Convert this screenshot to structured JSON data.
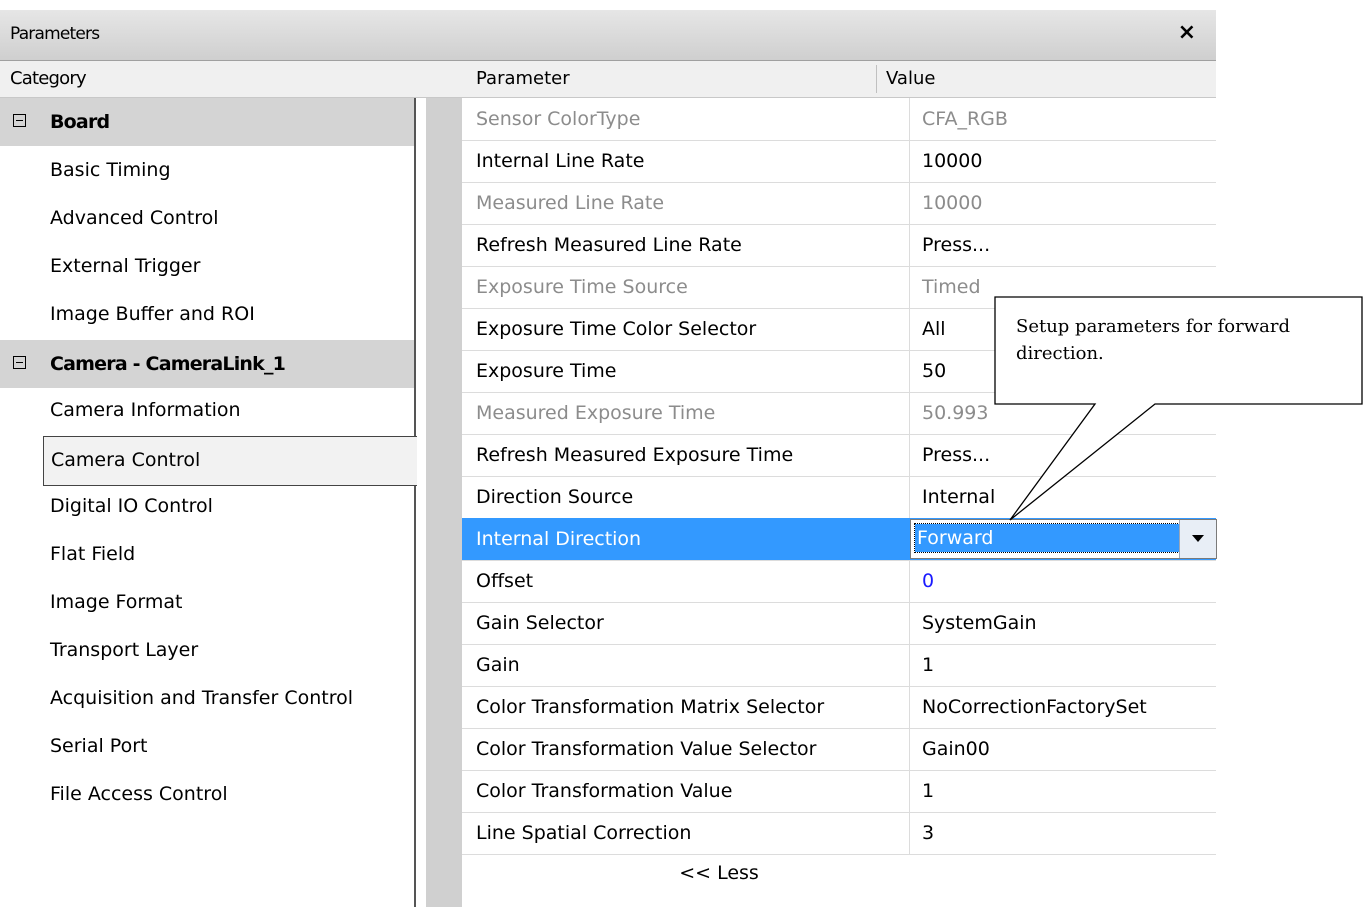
{
  "window": {
    "title": "Parameters",
    "close_symbol": "×"
  },
  "headers": {
    "category": "Category",
    "parameter": "Parameter",
    "value": "Value"
  },
  "categories": {
    "board_group": "Board",
    "board_items": [
      "Basic Timing",
      "Advanced Control",
      "External Trigger",
      "Image Buffer and ROI"
    ],
    "camera_group": "Camera - CameraLink_1",
    "camera_items": [
      "Camera Information",
      "Camera Control",
      "Digital IO Control",
      "Flat Field",
      "Image Format",
      "Transport Layer",
      "Acquisition and Transfer Control",
      "Serial Port",
      "File Access Control"
    ],
    "selected": "Camera Control"
  },
  "parameters": [
    {
      "name": "Sensor ColorType",
      "value": "CFA_RGB",
      "readonly": true
    },
    {
      "name": "Internal Line Rate",
      "value": "10000",
      "readonly": false
    },
    {
      "name": "Measured Line Rate",
      "value": "10000",
      "readonly": true
    },
    {
      "name": "Refresh Measured Line Rate",
      "value": "Press...",
      "readonly": false
    },
    {
      "name": "Exposure Time Source",
      "value": "Timed",
      "readonly": true
    },
    {
      "name": "Exposure Time Color Selector",
      "value": "All",
      "readonly": false
    },
    {
      "name": "Exposure Time",
      "value": "50",
      "readonly": false
    },
    {
      "name": "Measured Exposure Time",
      "value": "50.993",
      "readonly": true
    },
    {
      "name": "Refresh Measured Exposure Time",
      "value": "Press...",
      "readonly": false
    },
    {
      "name": "Direction Source",
      "value": "Internal",
      "readonly": false
    },
    {
      "name": "Internal Direction",
      "value": "Forward",
      "readonly": false,
      "selected": true,
      "dropdown": true
    },
    {
      "name": "Offset",
      "value": "0",
      "readonly": false,
      "value_color": "#1a1aff"
    },
    {
      "name": "Gain Selector",
      "value": "SystemGain",
      "readonly": false
    },
    {
      "name": "Gain",
      "value": "1",
      "readonly": false
    },
    {
      "name": "Color Transformation Matrix Selector",
      "value": "NoCorrectionFactorySet",
      "readonly": false
    },
    {
      "name": "Color Transformation Value Selector",
      "value": "Gain00",
      "readonly": false
    },
    {
      "name": "Color Transformation Value",
      "value": "1",
      "readonly": false
    },
    {
      "name": "Line Spatial Correction",
      "value": "3",
      "readonly": false
    }
  ],
  "less_button": "<< Less",
  "callout": {
    "text": "Setup parameters for forward direction."
  },
  "colors": {
    "selection": "#3399ff",
    "group_header": "#d4d4d4",
    "readonly_text": "#8c8c8c"
  }
}
